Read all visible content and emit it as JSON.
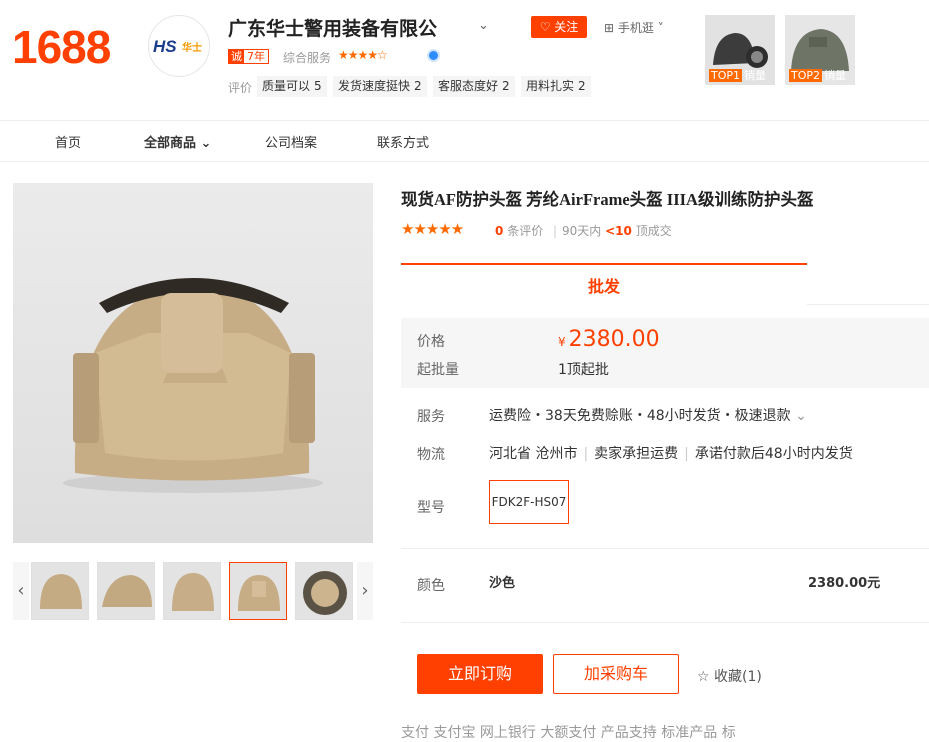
{
  "header": {
    "site_logo": "1688",
    "shop_logo_text": "华士",
    "shop_name": "广东华士警用装备有限公",
    "follow_label": "关注",
    "mobile_label": "手机逛",
    "years_badge": {
      "left": "诚",
      "right": "7年"
    },
    "service_label": "综合服务",
    "rating_stars": "★★★★☆",
    "eval_label": "评价",
    "eval_tags": [
      {
        "label": "质量可以",
        "count": "5"
      },
      {
        "label": "发货速度挺快",
        "count": "2"
      },
      {
        "label": "客服态度好",
        "count": "2"
      },
      {
        "label": "用料扎实",
        "count": "2"
      }
    ],
    "top_items": [
      {
        "rank": "TOP1",
        "label": "销量"
      },
      {
        "rank": "TOP2",
        "label": "销量"
      }
    ]
  },
  "nav": {
    "items": [
      "首页",
      "全部商品",
      "公司档案",
      "联系方式"
    ]
  },
  "product": {
    "title": "现货AF防护头盔 芳纶AirFrame头盔 IIIA级训练防护头盔",
    "stars": "★★★★★",
    "review_count": "0",
    "review_label": "条评价",
    "days_label": "90天内",
    "sold_value": "<10",
    "sold_unit": "顶成交",
    "tab_label": "批发",
    "price_label": "价格",
    "price_currency": "¥",
    "price": "2380.00",
    "min_label": "起批量",
    "min_value": "1顶起批",
    "service_label": "服务",
    "service_value": "运费险・38天免费赊账・48小时发货・极速退款",
    "logistics_label": "物流",
    "logistics_origin": "河北省 沧州市",
    "logistics_fee": "卖家承担运费",
    "logistics_ship": "承诺付款后48小时内发货",
    "model_label": "型号",
    "model_value": "FDK2F-HS07",
    "color_label": "颜色",
    "color_value": "沙色",
    "color_price": "2380.00元",
    "buy_label": "立即订购",
    "cart_label": "加采购车",
    "fav_label": "收藏(1)",
    "bottom_text": "支付        支付宝  网上银行  大额支付                产品支持      标准产品  标"
  },
  "colors": {
    "accent": "#ff4000",
    "helmet": "#c8b08a"
  }
}
